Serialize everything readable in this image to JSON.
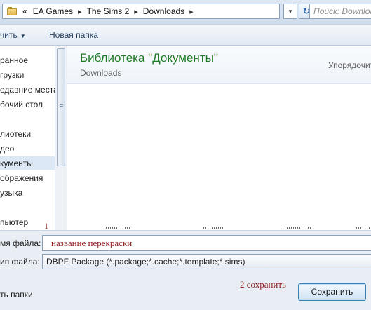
{
  "address_bar": {
    "crumbs": [
      "EA Games",
      "The Sims 2",
      "Downloads"
    ],
    "root_glyph": "«",
    "separator": "▸",
    "search_placeholder": "Поиск: Downloads"
  },
  "toolbar": {
    "organize_label": "чить",
    "new_folder_label": "Новая папка"
  },
  "nav_pane": {
    "items": [
      {
        "label": "ранное"
      },
      {
        "label": "грузки"
      },
      {
        "label": "едавние места"
      },
      {
        "label": "бочий стол"
      },
      {
        "label": "лиотеки"
      },
      {
        "label": "део"
      },
      {
        "label": "кументы",
        "selected": true
      },
      {
        "label": "ображения"
      },
      {
        "label": "узыка"
      },
      {
        "label": "пьютер"
      }
    ]
  },
  "library": {
    "title": "Библиотека \"Документы\"",
    "subtitle": "Downloads",
    "arrange_label": "Упорядочить"
  },
  "bottom": {
    "file_name_label": "мя файла:",
    "file_name_value": "название перекраски",
    "file_type_label": "ип файла:",
    "file_type_value": "DBPF Package (*.package;*.cache;*.template;*.sims)",
    "hide_folders_label": "ть папки",
    "save_label": "Сохранить"
  },
  "annotations": {
    "step1": "1",
    "step2": "2 сохранить"
  },
  "colors": {
    "library_title": "#1e7a26",
    "annotation": "#8b1a1a",
    "save_border": "#3c7fb1"
  }
}
